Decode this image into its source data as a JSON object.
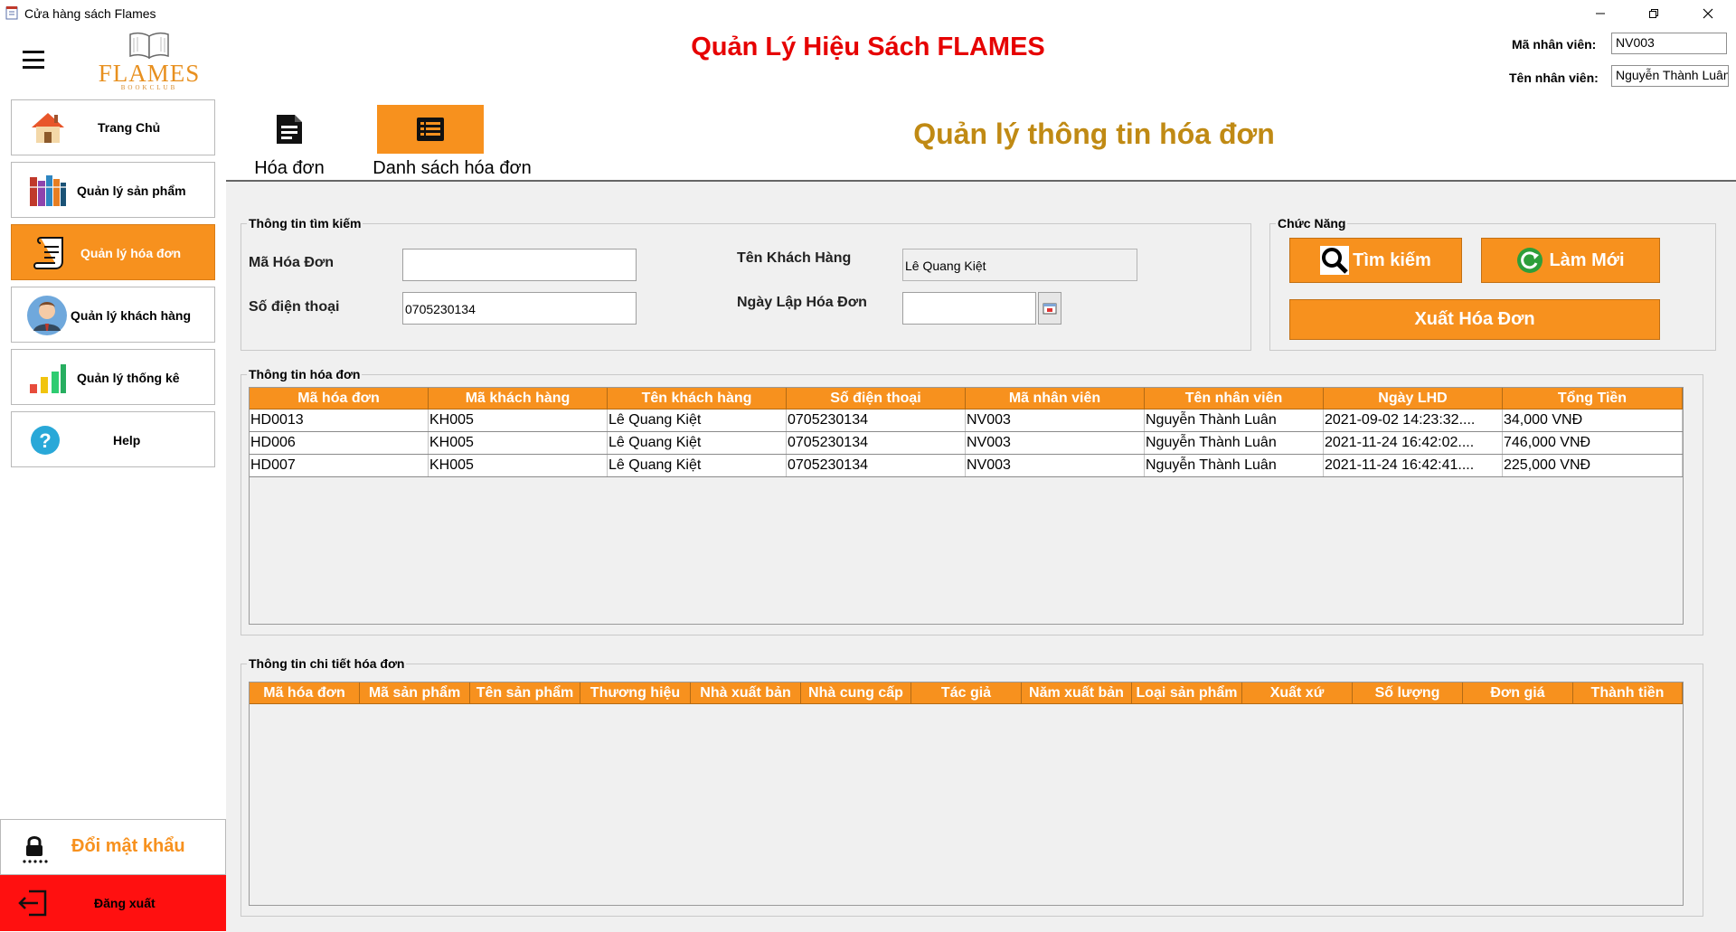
{
  "window": {
    "title": "Cửa hàng sách Flames"
  },
  "header": {
    "app_title": "Quản Lý Hiệu Sách FLAMES",
    "logo_text": "FLAMES",
    "logo_subtext": "BOOKCLUB",
    "employee_id_label": "Mã nhân viên:",
    "employee_id_value": "NV003",
    "employee_name_label": "Tên nhân viên:",
    "employee_name_value": "Nguyễn Thành Luân"
  },
  "sidebar": {
    "items": [
      {
        "label": "Trang Chủ",
        "icon": "house-icon"
      },
      {
        "label": "Quản lý sản phẩm",
        "icon": "books-icon"
      },
      {
        "label": "Quản lý hóa đơn",
        "icon": "invoice-scroll-icon",
        "active": true
      },
      {
        "label": "Quản lý khách hàng",
        "icon": "customer-avatar-icon"
      },
      {
        "label": "Quản lý thống kê",
        "icon": "bar-chart-icon"
      },
      {
        "label": "Help",
        "icon": "help-icon"
      }
    ],
    "change_password_label": "Đổi mật khẩu",
    "logout_label": "Đăng xuất"
  },
  "tabs": [
    {
      "label": "Hóa đơn",
      "icon": "document-icon"
    },
    {
      "label": "Danh sách hóa đơn",
      "icon": "list-icon",
      "active": true
    }
  ],
  "section_title": "Quản lý thông tin hóa đơn",
  "search": {
    "group_title": "Thông tin tìm kiếm",
    "invoice_id_label": "Mã Hóa Đơn",
    "invoice_id_value": "",
    "phone_label": "Số điện thoại",
    "phone_value": "0705230134",
    "customer_name_label": "Tên Khách Hàng",
    "customer_name_value": "Lê Quang Kiệt",
    "date_label": "Ngày Lập Hóa Đơn",
    "date_value": ""
  },
  "functions": {
    "group_title": "Chức Năng",
    "search_button": "Tìm kiếm",
    "refresh_button": "Làm Mới",
    "export_button": "Xuất Hóa Đơn"
  },
  "invoice_table": {
    "group_title": "Thông tin hóa đơn",
    "columns": [
      "Mã hóa đơn",
      "Mã khách hàng",
      "Tên khách hàng",
      "Số điện thoại",
      "Mã nhân viên",
      "Tên nhân viên",
      "Ngày LHD",
      "Tổng Tiền"
    ],
    "rows": [
      [
        "HD0013",
        "KH005",
        "Lê Quang Kiệt",
        "0705230134",
        "NV003",
        "Nguyễn Thành Luân",
        "2021-09-02 14:23:32....",
        "34,000 VNĐ"
      ],
      [
        "HD006",
        "KH005",
        "Lê Quang Kiệt",
        "0705230134",
        "NV003",
        "Nguyễn Thành Luân",
        "2021-11-24 16:42:02....",
        "746,000 VNĐ"
      ],
      [
        "HD007",
        "KH005",
        "Lê Quang Kiệt",
        "0705230134",
        "NV003",
        "Nguyễn Thành Luân",
        "2021-11-24 16:42:41....",
        "225,000 VNĐ"
      ]
    ]
  },
  "detail_table": {
    "group_title": "Thông tin chi tiết hóa đơn",
    "columns": [
      "Mã hóa đơn",
      "Mã sản phẩm",
      "Tên sản phẩm",
      "Thương hiệu",
      "Nhà xuất bản",
      "Nhà cung cấp",
      "Tác giả",
      "Năm xuất bản",
      "Loại sản phẩm",
      "Xuất xứ",
      "Số lượng",
      "Đơn giá",
      "Thành tiền"
    ],
    "rows": []
  },
  "colors": {
    "accent_orange": "#f7911e",
    "title_red": "#e60000",
    "section_gold": "#c08a14",
    "logout_red": "#ff1010",
    "logo_orange": "#e8901f"
  }
}
